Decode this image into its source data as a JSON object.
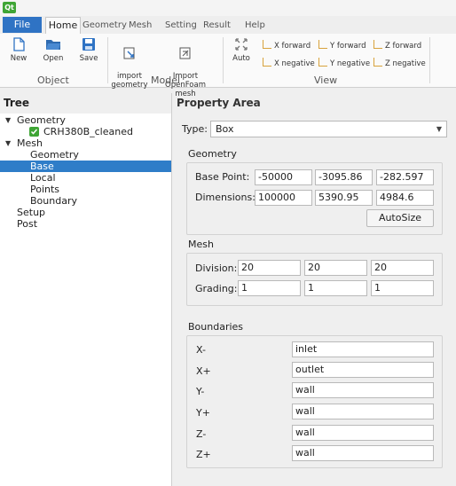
{
  "app": {
    "logo_text": "Qt"
  },
  "tabs": [
    "File",
    "Home",
    "Geometry",
    "Mesh",
    "Setting",
    "Result",
    "Help"
  ],
  "ribbon": {
    "object": {
      "group": "Object",
      "new": "New",
      "open": "Open",
      "save": "Save"
    },
    "model": {
      "group": "Model",
      "import_geometry": "import\ngeometry",
      "import_openfoam": "Import OpenFoam\nmesh"
    },
    "view": {
      "group": "View",
      "auto": "Auto",
      "x_forward": "X forward",
      "y_forward": "Y forward",
      "z_forward": "Z forward",
      "x_negative": "X negative",
      "y_negative": "Y negative",
      "z_negative": "Z negative"
    }
  },
  "tree": {
    "title": "Tree",
    "geometry": "Geometry",
    "geometry_item": "CRH380B_cleaned",
    "mesh": "Mesh",
    "mesh_children": [
      "Geometry",
      "Base",
      "Local",
      "Points",
      "Boundary"
    ],
    "setup": "Setup",
    "post": "Post",
    "selected": "Base"
  },
  "property": {
    "title": "Property Area",
    "type_label": "Type:",
    "type_value": "Box",
    "geometry": {
      "title": "Geometry",
      "base_point_label": "Base Point:",
      "base_point": [
        "-50000",
        "-3095.86",
        "-282.597"
      ],
      "dimensions_label": "Dimensions:",
      "dimensions": [
        "100000",
        "5390.95",
        "4984.6"
      ],
      "autosize": "AutoSize"
    },
    "mesh": {
      "title": "Mesh",
      "division_label": "Division:",
      "division": [
        "20",
        "20",
        "20"
      ],
      "grading_label": "Grading:",
      "grading": [
        "1",
        "1",
        "1"
      ]
    },
    "boundaries": {
      "title": "Boundaries",
      "items": [
        {
          "name": "X-",
          "value": "inlet"
        },
        {
          "name": "X+",
          "value": "outlet"
        },
        {
          "name": "Y-",
          "value": "wall"
        },
        {
          "name": "Y+",
          "value": "wall"
        },
        {
          "name": "Z-",
          "value": "wall"
        },
        {
          "name": "Z+",
          "value": "wall"
        }
      ]
    }
  },
  "colors": {
    "accent": "#2f73c4",
    "selection": "#2f7dc8",
    "check": "#3fa535"
  }
}
